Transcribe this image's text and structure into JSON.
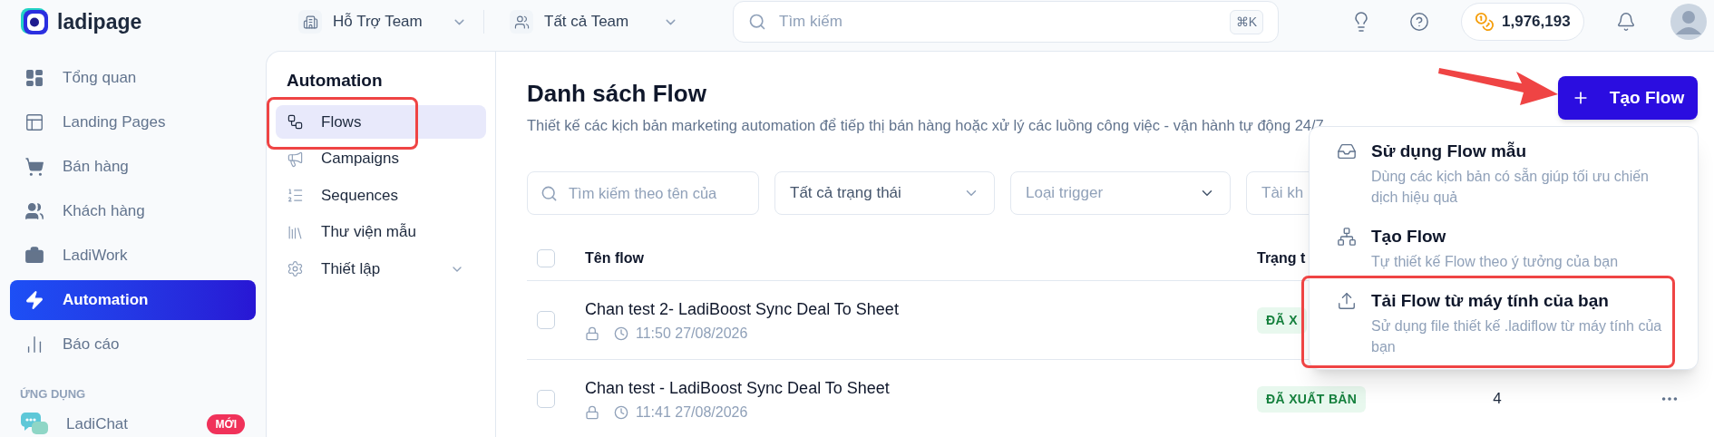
{
  "brand": {
    "name": "ladipage"
  },
  "team_selectors": [
    {
      "label": "Hỗ Trợ Team"
    },
    {
      "label": "Tất cả Team"
    }
  ],
  "search": {
    "placeholder": "Tìm kiếm",
    "shortcut": "⌘K"
  },
  "credits": "1,976,193",
  "sidebar": {
    "items": [
      {
        "label": "Tổng quan",
        "selected": false
      },
      {
        "label": "Landing Pages",
        "selected": false
      },
      {
        "label": "Bán hàng",
        "selected": false
      },
      {
        "label": "Khách hàng",
        "selected": false
      },
      {
        "label": "LadiWork",
        "selected": false
      },
      {
        "label": "Automation",
        "selected": true
      },
      {
        "label": "Báo cáo",
        "selected": false
      }
    ],
    "section_label": "ỨNG DỤNG",
    "apps": [
      {
        "label": "LadiChat",
        "badge": "MỚI"
      }
    ]
  },
  "submenu": {
    "title": "Automation",
    "items": [
      {
        "label": "Flows",
        "selected": true,
        "annotated": true
      },
      {
        "label": "Campaigns",
        "selected": false,
        "annotated": false
      },
      {
        "label": "Sequences",
        "selected": false,
        "annotated": false
      },
      {
        "label": "Thư viện mẫu",
        "selected": false,
        "annotated": false
      },
      {
        "label": "Thiết lập",
        "selected": false,
        "annotated": false,
        "expanded": false
      }
    ]
  },
  "page": {
    "title": "Danh sách Flow",
    "description": "Thiết kế các kịch bản marketing automation để tiếp thị bán hàng hoặc xử lý các luồng công việc - vận hành tự động 24/7",
    "create_button": "Tạo Flow"
  },
  "filters": [
    {
      "kind": "search",
      "placeholder": "Tìm kiếm theo tên của"
    },
    {
      "kind": "select",
      "value": "Tất cả trạng thái"
    },
    {
      "kind": "select",
      "placeholder": "Loại trigger"
    },
    {
      "kind": "select",
      "placeholder": "Tài kh"
    }
  ],
  "table": {
    "columns": [
      "Tên flow",
      "Trạng t"
    ],
    "header_checked": false,
    "rows": [
      {
        "name": "Chan test 2- LadiBoost Sync Deal To Sheet",
        "time": "11:50 27/08/2026",
        "status": "ĐÃ X",
        "checked": false
      },
      {
        "name": "Chan test - LadiBoost Sync Deal To Sheet",
        "time": "11:41 27/08/2026",
        "status": "ĐÃ XUẤT BẢN",
        "count": "4",
        "checked": false
      }
    ]
  },
  "create_menu": {
    "open": true,
    "items": [
      {
        "title": "Sử dụng Flow mẫu",
        "description": "Dùng các kịch bản có sẵn giúp tối ưu chiến dịch hiệu quả",
        "annotated": false
      },
      {
        "title": "Tạo Flow",
        "description": "Tự thiết kế Flow theo ý tưởng của bạn",
        "annotated": false
      },
      {
        "title": "Tải Flow từ máy tính của bạn",
        "description": "Sử dụng file thiết kế .ladiflow từ máy tính của bạn",
        "annotated": true
      }
    ]
  }
}
